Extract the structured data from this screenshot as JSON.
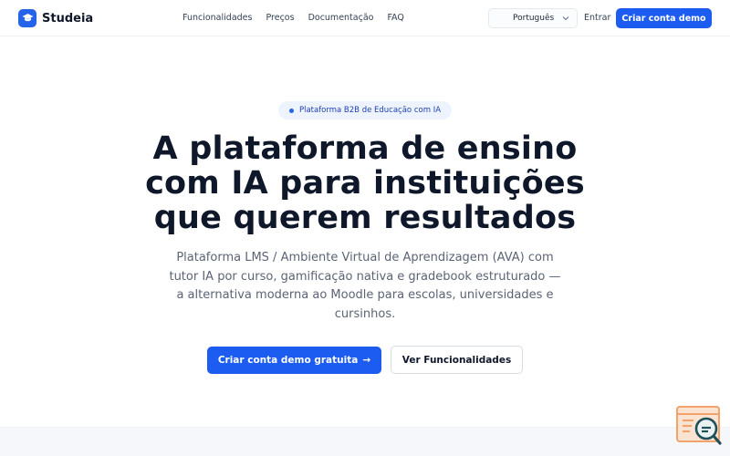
{
  "header": {
    "brand": "Studeia",
    "nav": [
      "Funcionalidades",
      "Preços",
      "Documentação",
      "FAQ"
    ],
    "language": "Português",
    "login": "Entrar",
    "demo_button": "Criar conta demo"
  },
  "hero": {
    "badge": "Plataforma B2B de Educação com IA",
    "title_lines": [
      "A plataforma de ensino",
      "com IA para instituições",
      "que querem resultados"
    ],
    "subtitle_lines": [
      "Plataforma LMS / Ambiente Virtual de Aprendizagem (AVA) com",
      "tutor IA por curso, gamificação nativa e gradebook estruturado —",
      "a alternativa moderna ao Moodle para escolas, universidades e",
      "cursinhos."
    ],
    "cta_primary": "Criar conta demo gratuita",
    "cta_primary_arrow": "→",
    "cta_secondary": "Ver Funcionalidades"
  },
  "colors": {
    "accent": "#1d5cf0",
    "widget_orange": "#f0a36b",
    "widget_teal": "#1f4f57"
  },
  "icons": {
    "brand": "graduation-cap-icon",
    "language_chevron": "chevron-down-icon",
    "widget": "search-chat-icon"
  }
}
